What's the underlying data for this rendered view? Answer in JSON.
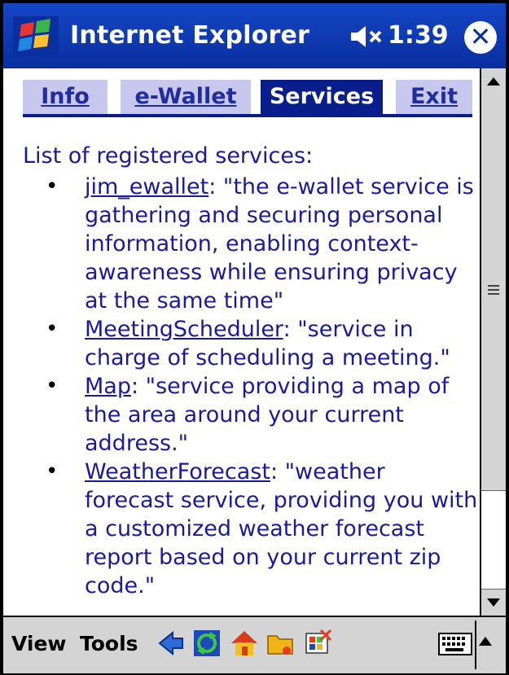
{
  "titlebar": {
    "app_title": "Internet Explorer",
    "time": "1:39",
    "close_glyph": "✕"
  },
  "tabs": [
    {
      "label": "Info",
      "active": false
    },
    {
      "label": "e-Wallet",
      "active": false
    },
    {
      "label": "Services",
      "active": true
    },
    {
      "label": "Exit",
      "active": false
    }
  ],
  "page": {
    "heading": "List of registered services:",
    "services": [
      {
        "name": "jim_ewallet",
        "description": ": \"the e-wallet service is gathering and securing personal information, enabling context-awareness while ensuring privacy at the same time\""
      },
      {
        "name": "MeetingScheduler",
        "description": ": \"service in charge of scheduling a meeting.\""
      },
      {
        "name": "Map",
        "description": ": \"service providing a map of the area around your current address.\""
      },
      {
        "name": "WeatherForecast",
        "description": ": \"weather forecast service, providing you with a customized weather forecast report based on your current zip code.\""
      }
    ]
  },
  "toolbar": {
    "view_label": "View",
    "tools_label": "Tools",
    "icons": [
      "back-icon",
      "refresh-icon",
      "home-icon",
      "favorites-icon",
      "desktop-view-icon"
    ]
  },
  "colors": {
    "titlebar": "#0a2f9e",
    "link_text": "#1a1aa0",
    "tab_active": "#0a1d8c",
    "tab_inactive": "#c8c8ee",
    "toolbar": "#d4d4d4"
  }
}
